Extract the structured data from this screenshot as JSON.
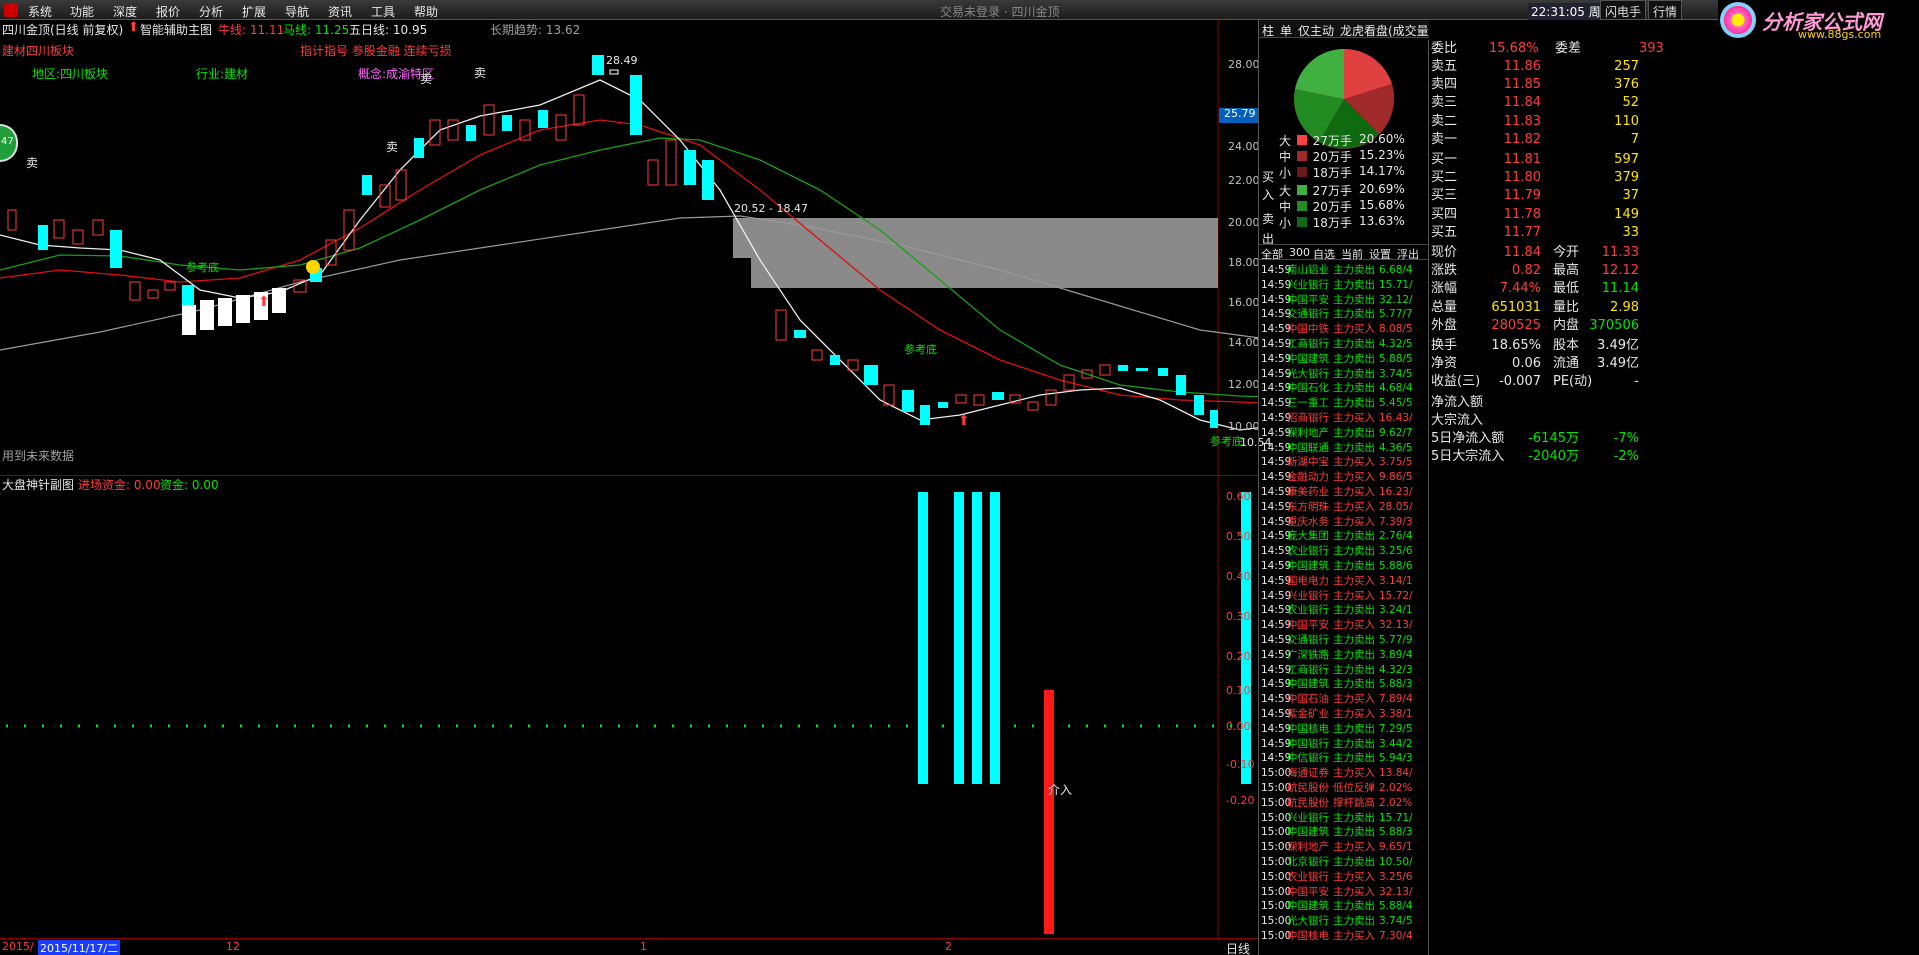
{
  "menu": {
    "items": [
      "系统",
      "功能",
      "深度",
      "报价",
      "分析",
      "扩展",
      "导航",
      "资讯",
      "工具",
      "帮助"
    ],
    "window_title": "交易未登录 · 四川金顶",
    "clock": "22:31:05 周三",
    "tabs": [
      "闪电手",
      "行情"
    ]
  },
  "brand": {
    "name": "分析家公式网",
    "url": "www.88gs.com"
  },
  "main_chart": {
    "header": {
      "stock": "四川金顶(日线 前复权)",
      "indicator": "智能辅助主图",
      "ma_labels": [
        {
          "label": "牛线: 11.11",
          "color": "#ff3c3c"
        },
        {
          "label": "马线: 11.25",
          "color": "#00e600"
        },
        {
          "label": "五日线: 10.95",
          "color": "#e8e8e8"
        }
      ],
      "trend_label": "长期趋势: 13.62",
      "sector_red": "建材四川板块",
      "signals_red": "指计指号 参股金融 连续亏损",
      "region": "地区:四川板块",
      "industry": "行业:建材",
      "concept": "概念:成渝特区",
      "future_note": "用到未来数据"
    },
    "annotations": {
      "high": "28.49",
      "range": "20.52 - 18.47",
      "low": "10.54",
      "sell": "卖",
      "ref_bottom": "参考底",
      "current_price_tag": "25.79",
      "left_badge": "47"
    },
    "y_ticks": [
      "28.00",
      "26.00",
      "24.00",
      "22.00",
      "20.00",
      "18.00",
      "16.00",
      "14.00",
      "12.00",
      "10.00"
    ]
  },
  "sub_chart": {
    "header": {
      "title": "大盘神针副图",
      "field1": "进场资金: 0.00",
      "field2": "资金: 0.00"
    },
    "y_ticks": [
      "0.60",
      "0.50",
      "0.40",
      "0.30",
      "0.20",
      "0.10",
      "0.00",
      "-0.10",
      "-0.20"
    ],
    "intervene_label": "介入"
  },
  "bottom_axis": {
    "labels": [
      "2015/",
      "2015/11/17/二",
      "12",
      "1",
      "2",
      "3"
    ],
    "period": "日线"
  },
  "mid_panel": {
    "tabs": [
      "柱",
      "单",
      "仅主动",
      "龙虎看盘(成交量)"
    ],
    "flow_header": [
      "买",
      "入",
      "卖",
      "出"
    ],
    "buy_rows": [
      {
        "size": "大",
        "amount": "27万手",
        "pct": "20.60%"
      },
      {
        "size": "中",
        "amount": "20万手",
        "pct": "15.23%"
      },
      {
        "size": "小",
        "amount": "18万手",
        "pct": "14.17%"
      }
    ],
    "sell_rows": [
      {
        "size": "大",
        "amount": "27万手",
        "pct": "20.69%"
      },
      {
        "size": "中",
        "amount": "20万手",
        "pct": "15.68%"
      },
      {
        "size": "小",
        "amount": "18万手",
        "pct": "13.63%"
      }
    ],
    "filter_tabs": [
      "全部",
      "300",
      "自选",
      "当前",
      "设置",
      "浮出"
    ],
    "trades": [
      [
        "14:59",
        "南山铝业",
        "主力卖出",
        "6.68/4"
      ],
      [
        "14:59",
        "兴业银行",
        "主力卖出",
        "15.71/"
      ],
      [
        "14:59",
        "中国平安",
        "主力卖出",
        "32.12/"
      ],
      [
        "14:59",
        "交通银行",
        "主力卖出",
        "5.77/7"
      ],
      [
        "14:59",
        "中国中铁",
        "主力买入",
        "8.08/5"
      ],
      [
        "14:59",
        "工商银行",
        "主力卖出",
        "4.32/5"
      ],
      [
        "14:59",
        "中国建筑",
        "主力卖出",
        "5.88/5"
      ],
      [
        "14:59",
        "光大银行",
        "主力卖出",
        "3.74/5"
      ],
      [
        "14:59",
        "中国石化",
        "主力卖出",
        "4.68/4"
      ],
      [
        "14:59",
        "三一重工",
        "主力卖出",
        "5.45/5"
      ],
      [
        "14:59",
        "招商银行",
        "主力买入",
        "16.43/"
      ],
      [
        "14:59",
        "保利地产",
        "主力卖出",
        "9.62/7"
      ],
      [
        "14:59",
        "中国联通",
        "主力卖出",
        "4.36/5"
      ],
      [
        "14:59",
        "新湖中宝",
        "主力买入",
        "3.75/5"
      ],
      [
        "14:59",
        "金融动力",
        "主力买入",
        "9.86/5"
      ],
      [
        "14:59",
        "康美药业",
        "主力买入",
        "16.23/"
      ],
      [
        "14:59",
        "东方明珠",
        "主力买入",
        "28.05/"
      ],
      [
        "14:59",
        "重庆水务",
        "主力买入",
        "7.39/3"
      ],
      [
        "14:59",
        "庞大集团",
        "主力卖出",
        "2.76/4"
      ],
      [
        "14:59",
        "农业银行",
        "主力卖出",
        "3.25/6"
      ],
      [
        "14:59",
        "中国建筑",
        "主力卖出",
        "5.88/6"
      ],
      [
        "14:59",
        "国电电力",
        "主力买入",
        "3.14/1"
      ],
      [
        "14:59",
        "兴业银行",
        "主力买入",
        "15.72/"
      ],
      [
        "14:59",
        "农业银行",
        "主力卖出",
        "3.24/1"
      ],
      [
        "14:59",
        "中国平安",
        "主力买入",
        "32.13/"
      ],
      [
        "14:59",
        "交通银行",
        "主力卖出",
        "5.77/9"
      ],
      [
        "14:59",
        "广深铁路",
        "主力卖出",
        "3.89/4"
      ],
      [
        "14:59",
        "工商银行",
        "主力卖出",
        "4.32/3"
      ],
      [
        "14:59",
        "中国建筑",
        "主力卖出",
        "5.88/3"
      ],
      [
        "14:59",
        "中国石油",
        "主力买入",
        "7.89/4"
      ],
      [
        "14:59",
        "紫金矿业",
        "主力买入",
        "3.38/1"
      ],
      [
        "14:59",
        "中国核电",
        "主力卖出",
        "7.29/5"
      ],
      [
        "14:59",
        "中国银行",
        "主力卖出",
        "3.44/2"
      ],
      [
        "14:59",
        "中信银行",
        "主力卖出",
        "5.94/3"
      ],
      [
        "15:00",
        "海通证券",
        "主力买入",
        "13.84/"
      ],
      [
        "15:00",
        "航民股份",
        "低位反弹",
        "2.02%"
      ],
      [
        "15:00",
        "航民股份",
        "撑杆跳高",
        "2.02%"
      ],
      [
        "15:00",
        "兴业银行",
        "主力卖出",
        "15.71/"
      ],
      [
        "15:00",
        "中国建筑",
        "主力卖出",
        "5.88/3"
      ],
      [
        "15:00",
        "保利地产",
        "主力买入",
        "9.65/1"
      ],
      [
        "15:00",
        "北京银行",
        "主力卖出",
        "10.50/"
      ],
      [
        "15:00",
        "农业银行",
        "主力买入",
        "3.25/6"
      ],
      [
        "15:00",
        "中国平安",
        "主力买入",
        "32.13/"
      ],
      [
        "15:00",
        "中国建筑",
        "主力卖出",
        "5.88/4"
      ],
      [
        "15:00",
        "光大银行",
        "主力卖出",
        "3.74/5"
      ],
      [
        "15:00",
        "中国核电",
        "主力买入",
        "7.30/4"
      ]
    ]
  },
  "quote_panel": {
    "top_row": {
      "label": "委比",
      "value": "15.68%",
      "label2": "委差",
      "value2": "393"
    },
    "asks": [
      {
        "label": "卖五",
        "price": "11.86",
        "vol": "257"
      },
      {
        "label": "卖四",
        "price": "11.85",
        "vol": "376"
      },
      {
        "label": "卖三",
        "price": "11.84",
        "vol": "52"
      },
      {
        "label": "卖二",
        "price": "11.83",
        "vol": "110"
      },
      {
        "label": "卖一",
        "price": "11.82",
        "vol": "7"
      }
    ],
    "bids": [
      {
        "label": "买一",
        "price": "11.81",
        "vol": "597"
      },
      {
        "label": "买二",
        "price": "11.80",
        "vol": "379"
      },
      {
        "label": "买三",
        "price": "11.79",
        "vol": "37"
      },
      {
        "label": "买四",
        "price": "11.78",
        "vol": "149"
      },
      {
        "label": "买五",
        "price": "11.77",
        "vol": "33"
      }
    ],
    "stats": [
      {
        "l1": "现价",
        "v1": "11.84",
        "l2": "今开",
        "v2": "11.33"
      },
      {
        "l1": "涨跌",
        "v1": "0.82",
        "l2": "最高",
        "v2": "12.12"
      },
      {
        "l1": "涨幅",
        "v1": "7.44%",
        "l2": "最低",
        "v2": "11.14"
      },
      {
        "l1": "总量",
        "v1": "651031",
        "l2": "量比",
        "v2": "2.98"
      },
      {
        "l1": "外盘",
        "v1": "280525",
        "l2": "内盘",
        "v2": "370506"
      },
      {
        "l1": "换手",
        "v1": "18.65%",
        "l2": "股本",
        "v2": "3.49亿"
      },
      {
        "l1": "净资",
        "v1": "0.06",
        "l2": "流通",
        "v2": "3.49亿"
      },
      {
        "l1": "收益(三)",
        "v1": "-0.007",
        "l2": "PE(动)",
        "v2": "-"
      }
    ],
    "flow": [
      {
        "label": "净流入额",
        "value": ""
      },
      {
        "label": "大宗流入",
        "value": ""
      },
      {
        "label": "5日净流入额",
        "value": "-6145万",
        "pct": "-7%"
      },
      {
        "label": "5日大宗流入",
        "value": "-2040万",
        "pct": "-2%"
      }
    ]
  }
}
